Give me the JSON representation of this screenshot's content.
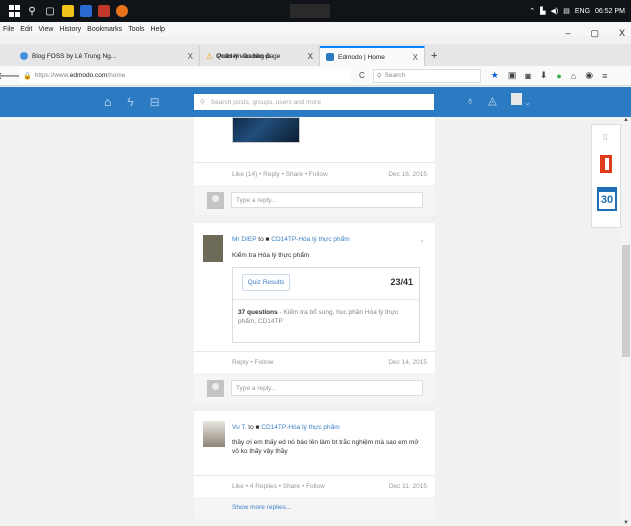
{
  "taskbar": {
    "lang": "ENG",
    "time": "06:52 PM"
  },
  "menubar": {
    "items": [
      "File",
      "Edit",
      "View",
      "History",
      "Bookmarks",
      "Tools",
      "Help"
    ]
  },
  "window_controls": {
    "minimize": "–",
    "maximize": "▢",
    "close": "X"
  },
  "tabs": [
    {
      "label": "Blog FOSS by Lê Trung Ng...",
      "close": "X"
    },
    {
      "label": "Quản lý văn bản đi",
      "close": "X"
    },
    {
      "label": "Problem loading page",
      "close": "X"
    },
    {
      "label": "Edmodo | Home",
      "close": "X"
    }
  ],
  "new_tab": "+",
  "address": {
    "scheme": "https://www.",
    "domain": "edmodo.com",
    "path": "/home"
  },
  "browser_search": {
    "placeholder": "Search"
  },
  "edmodo": {
    "search_placeholder": "Search posts, groups, users and more"
  },
  "posts": [
    {
      "id": "post-1",
      "actions": "Like (14) • Reply • Share • Follow",
      "date": "Dec 16, 2015",
      "reply_placeholder": "Type a reply..."
    },
    {
      "id": "post-2",
      "author": "Mr DIEP",
      "to": "to",
      "group": "CD14TP-Hóa lý thực phẩm",
      "title": "Kiểm tra Hóa lý thực phẩm",
      "quiz_button": "Quiz Results",
      "quiz_score": "23/41",
      "quiz_count": "37 questions",
      "quiz_desc": " - Kiểm tra bổ sung, học phần Hóa lý thực phẩm, CD14TP",
      "actions": "Reply • Follow",
      "date": "Dec 14, 2015",
      "reply_placeholder": "Type a reply..."
    },
    {
      "id": "post-3",
      "author": "Vu T.",
      "to": "to",
      "group": "CD14TP-Hóa lý thực phẩm",
      "text": "thầy ơi em thấy ed nó báo lên làm bt trắc nghiệm mà sao em mở vô ko thấy vậy thầy",
      "actions": "Like • 4 Replies • Share • Follow",
      "date": "Dec 11, 2015",
      "more": "Show more replies..."
    }
  ],
  "side_widgets": {
    "calendar_day": "30"
  }
}
